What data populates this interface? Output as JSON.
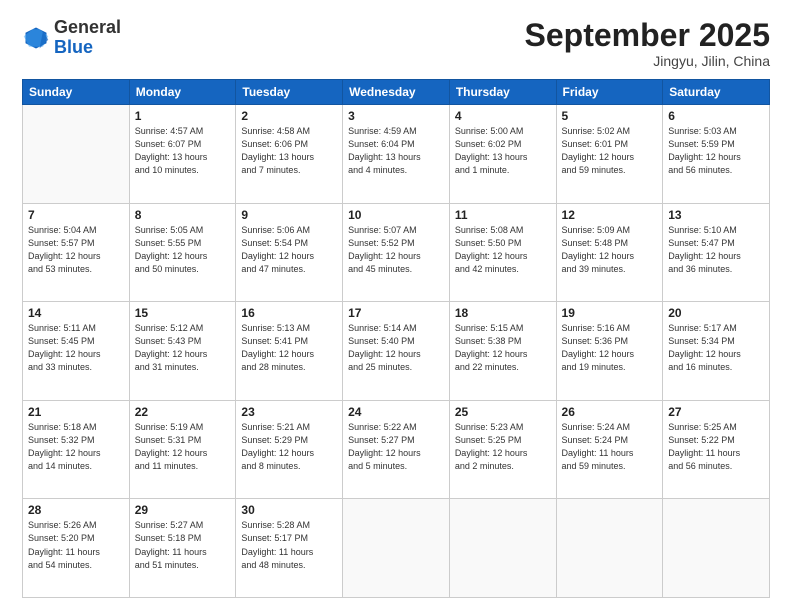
{
  "header": {
    "logo_general": "General",
    "logo_blue": "Blue",
    "month_title": "September 2025",
    "subtitle": "Jingyu, Jilin, China"
  },
  "weekdays": [
    "Sunday",
    "Monday",
    "Tuesday",
    "Wednesday",
    "Thursday",
    "Friday",
    "Saturday"
  ],
  "weeks": [
    [
      {
        "day": "",
        "info": ""
      },
      {
        "day": "1",
        "info": "Sunrise: 4:57 AM\nSunset: 6:07 PM\nDaylight: 13 hours\nand 10 minutes."
      },
      {
        "day": "2",
        "info": "Sunrise: 4:58 AM\nSunset: 6:06 PM\nDaylight: 13 hours\nand 7 minutes."
      },
      {
        "day": "3",
        "info": "Sunrise: 4:59 AM\nSunset: 6:04 PM\nDaylight: 13 hours\nand 4 minutes."
      },
      {
        "day": "4",
        "info": "Sunrise: 5:00 AM\nSunset: 6:02 PM\nDaylight: 13 hours\nand 1 minute."
      },
      {
        "day": "5",
        "info": "Sunrise: 5:02 AM\nSunset: 6:01 PM\nDaylight: 12 hours\nand 59 minutes."
      },
      {
        "day": "6",
        "info": "Sunrise: 5:03 AM\nSunset: 5:59 PM\nDaylight: 12 hours\nand 56 minutes."
      }
    ],
    [
      {
        "day": "7",
        "info": "Sunrise: 5:04 AM\nSunset: 5:57 PM\nDaylight: 12 hours\nand 53 minutes."
      },
      {
        "day": "8",
        "info": "Sunrise: 5:05 AM\nSunset: 5:55 PM\nDaylight: 12 hours\nand 50 minutes."
      },
      {
        "day": "9",
        "info": "Sunrise: 5:06 AM\nSunset: 5:54 PM\nDaylight: 12 hours\nand 47 minutes."
      },
      {
        "day": "10",
        "info": "Sunrise: 5:07 AM\nSunset: 5:52 PM\nDaylight: 12 hours\nand 45 minutes."
      },
      {
        "day": "11",
        "info": "Sunrise: 5:08 AM\nSunset: 5:50 PM\nDaylight: 12 hours\nand 42 minutes."
      },
      {
        "day": "12",
        "info": "Sunrise: 5:09 AM\nSunset: 5:48 PM\nDaylight: 12 hours\nand 39 minutes."
      },
      {
        "day": "13",
        "info": "Sunrise: 5:10 AM\nSunset: 5:47 PM\nDaylight: 12 hours\nand 36 minutes."
      }
    ],
    [
      {
        "day": "14",
        "info": "Sunrise: 5:11 AM\nSunset: 5:45 PM\nDaylight: 12 hours\nand 33 minutes."
      },
      {
        "day": "15",
        "info": "Sunrise: 5:12 AM\nSunset: 5:43 PM\nDaylight: 12 hours\nand 31 minutes."
      },
      {
        "day": "16",
        "info": "Sunrise: 5:13 AM\nSunset: 5:41 PM\nDaylight: 12 hours\nand 28 minutes."
      },
      {
        "day": "17",
        "info": "Sunrise: 5:14 AM\nSunset: 5:40 PM\nDaylight: 12 hours\nand 25 minutes."
      },
      {
        "day": "18",
        "info": "Sunrise: 5:15 AM\nSunset: 5:38 PM\nDaylight: 12 hours\nand 22 minutes."
      },
      {
        "day": "19",
        "info": "Sunrise: 5:16 AM\nSunset: 5:36 PM\nDaylight: 12 hours\nand 19 minutes."
      },
      {
        "day": "20",
        "info": "Sunrise: 5:17 AM\nSunset: 5:34 PM\nDaylight: 12 hours\nand 16 minutes."
      }
    ],
    [
      {
        "day": "21",
        "info": "Sunrise: 5:18 AM\nSunset: 5:32 PM\nDaylight: 12 hours\nand 14 minutes."
      },
      {
        "day": "22",
        "info": "Sunrise: 5:19 AM\nSunset: 5:31 PM\nDaylight: 12 hours\nand 11 minutes."
      },
      {
        "day": "23",
        "info": "Sunrise: 5:21 AM\nSunset: 5:29 PM\nDaylight: 12 hours\nand 8 minutes."
      },
      {
        "day": "24",
        "info": "Sunrise: 5:22 AM\nSunset: 5:27 PM\nDaylight: 12 hours\nand 5 minutes."
      },
      {
        "day": "25",
        "info": "Sunrise: 5:23 AM\nSunset: 5:25 PM\nDaylight: 12 hours\nand 2 minutes."
      },
      {
        "day": "26",
        "info": "Sunrise: 5:24 AM\nSunset: 5:24 PM\nDaylight: 11 hours\nand 59 minutes."
      },
      {
        "day": "27",
        "info": "Sunrise: 5:25 AM\nSunset: 5:22 PM\nDaylight: 11 hours\nand 56 minutes."
      }
    ],
    [
      {
        "day": "28",
        "info": "Sunrise: 5:26 AM\nSunset: 5:20 PM\nDaylight: 11 hours\nand 54 minutes."
      },
      {
        "day": "29",
        "info": "Sunrise: 5:27 AM\nSunset: 5:18 PM\nDaylight: 11 hours\nand 51 minutes."
      },
      {
        "day": "30",
        "info": "Sunrise: 5:28 AM\nSunset: 5:17 PM\nDaylight: 11 hours\nand 48 minutes."
      },
      {
        "day": "",
        "info": ""
      },
      {
        "day": "",
        "info": ""
      },
      {
        "day": "",
        "info": ""
      },
      {
        "day": "",
        "info": ""
      }
    ]
  ]
}
